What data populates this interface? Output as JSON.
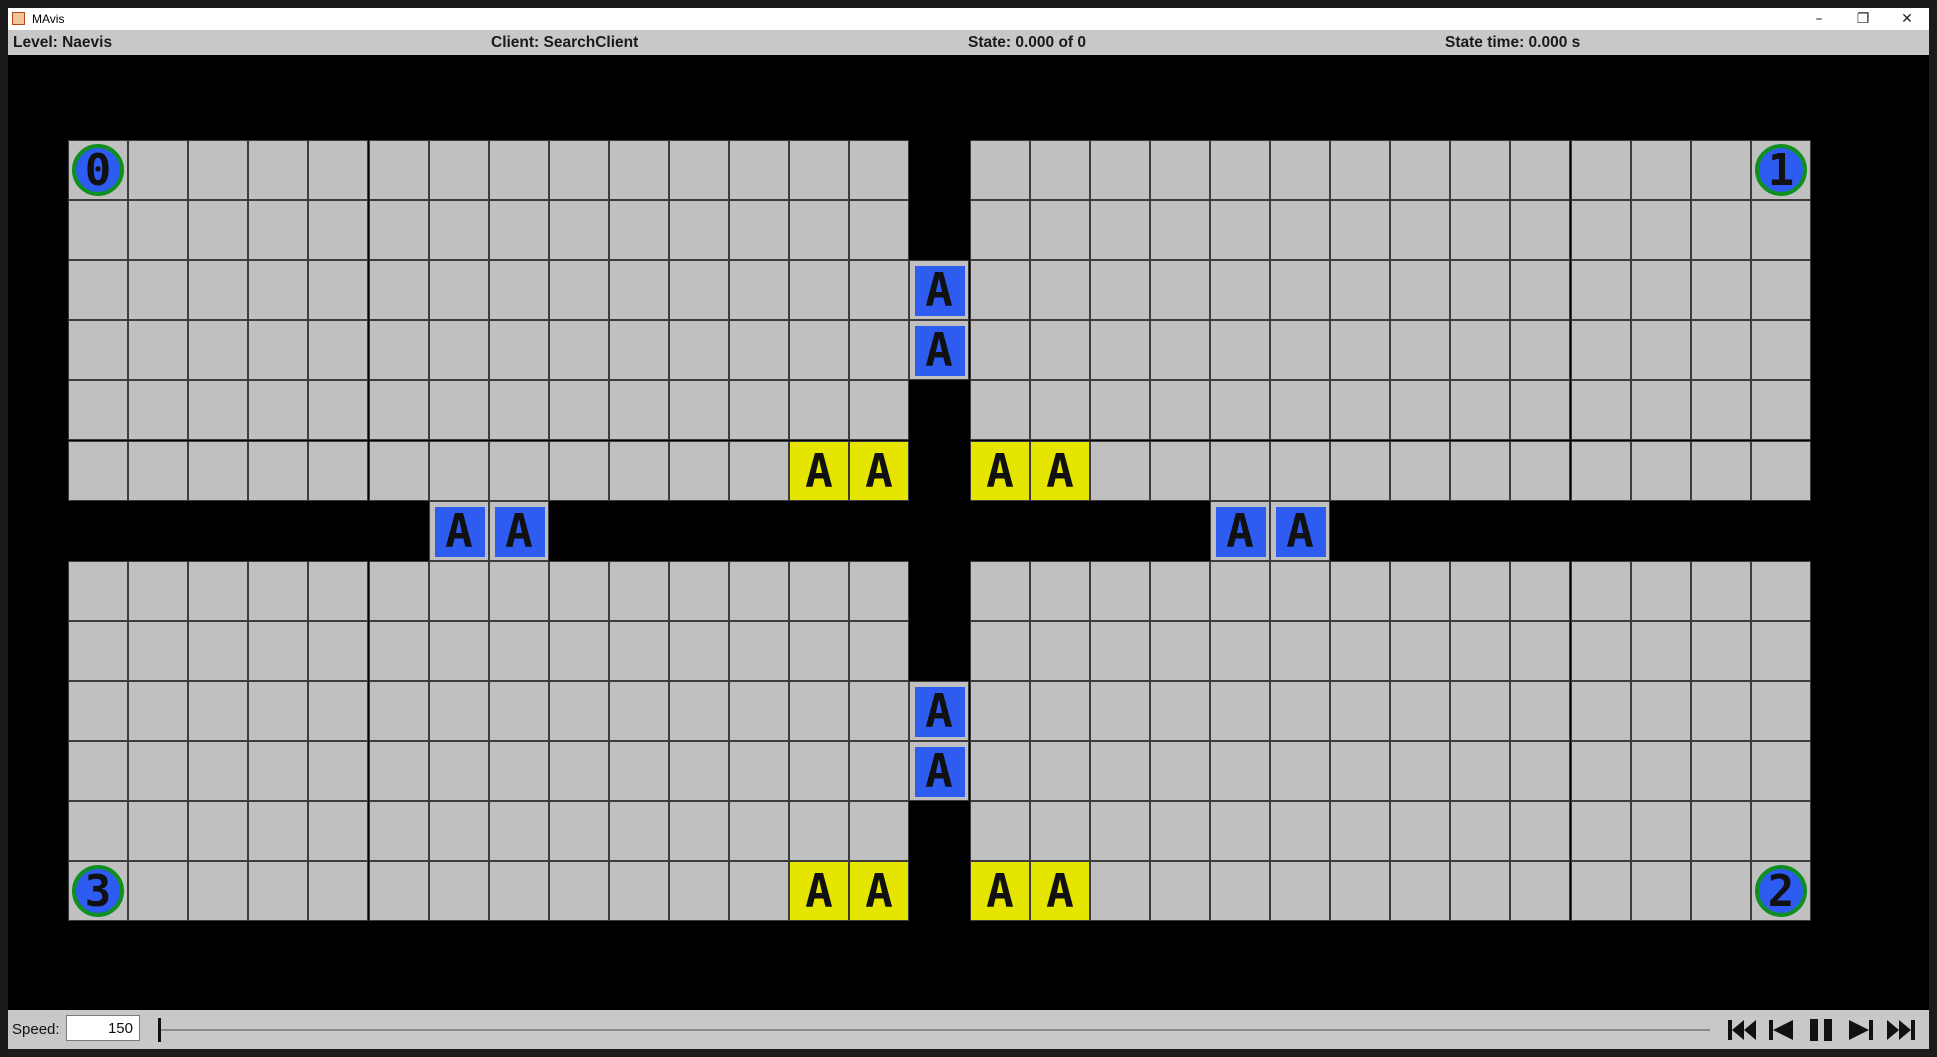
{
  "window": {
    "title": "MAvis",
    "buttons": {
      "minimize": "–",
      "restore": "❐",
      "close": "✕"
    }
  },
  "status": {
    "level": "Level: Naevis",
    "client": "Client: SearchClient",
    "state": "State: 0.000 of 0",
    "state_time": "State time: 0.000 s"
  },
  "grid": {
    "rows": 13,
    "cols": 30,
    "map": [
      "0.............#.............1",
      "..............#..............",
      "..............B..............",
      "..............B..............",
      "..............#..............",
      "............GG#GG............",
      "######BB###########BB########",
      "..............#..............",
      "..............#..............",
      "..............B..............",
      "..............B..............",
      "..............#..............",
      "3...........GG#GG...........2"
    ],
    "box_letter": "A",
    "colors": {
      "floor": "#c0c0c0",
      "wall": "#000000",
      "goal": "#e5e500",
      "box": "#2e5cf0",
      "agent_ring": "#0f8f1f"
    }
  },
  "controls": {
    "speed_label": "Speed:",
    "speed_value": "150",
    "buttons": [
      "skip-to-start",
      "step-back",
      "pause",
      "step-forward",
      "skip-to-end"
    ]
  }
}
